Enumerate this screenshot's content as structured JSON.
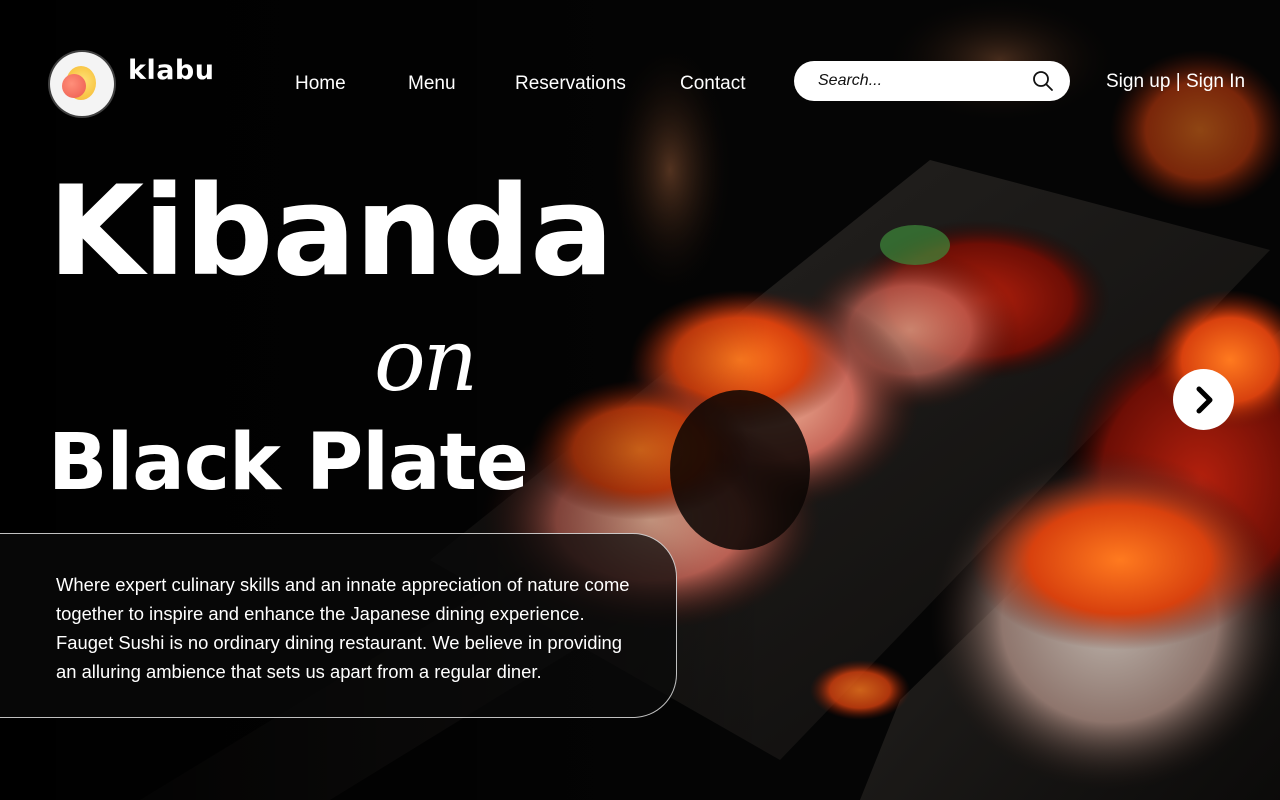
{
  "brand": {
    "name": "klabu",
    "logo_icon": "sun-moon-logo-icon"
  },
  "nav": {
    "items": [
      {
        "label": "Home"
      },
      {
        "label": "Menu"
      },
      {
        "label": "Reservations"
      },
      {
        "label": "Contact"
      }
    ]
  },
  "search": {
    "placeholder": "Search...",
    "value": "",
    "icon": "search-icon"
  },
  "auth": {
    "signup_label": "Sign up",
    "separator": " | ",
    "signin_label": "Sign In"
  },
  "hero": {
    "title_line_1": "Kibanda",
    "title_connector": "on",
    "title_line_2": "Black Plate",
    "description": "Where expert culinary skills and an innate appreciation of nature come together to inspire and enhance the Japanese dining experience. Fauget Sushi is no ordinary dining restaurant. We believe in providing an alluring ambience that sets us apart from a regular diner.",
    "next_icon": "chevron-right-icon"
  },
  "colors": {
    "background": "#050505",
    "text": "#ffffff",
    "accent_orange": "#e2541a",
    "logo_yellow": "#f9c94a",
    "logo_coral": "#f26a5b"
  }
}
